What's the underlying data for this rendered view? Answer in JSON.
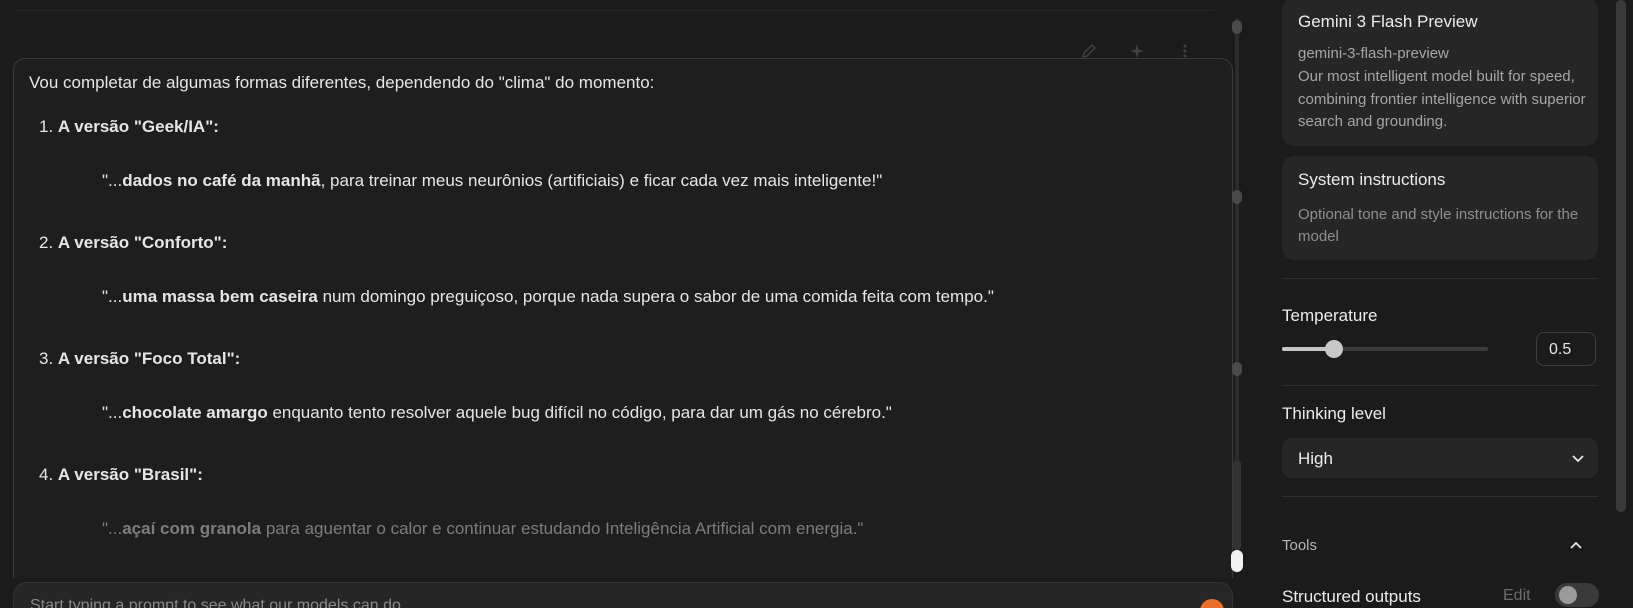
{
  "chat": {
    "intro": "Vou completar de algumas formas diferentes, dependendo do \"clima\" do momento:",
    "items": [
      {
        "num": "1.",
        "title": "A versão \"Geek/IA\":",
        "quote_prefix": "\"...",
        "quote_bold": "dados no café da manhã",
        "quote_rest": ", para treinar meus neurônios (artificiais) e ficar cada vez mais inteligente!\""
      },
      {
        "num": "2.",
        "title": "A versão \"Conforto\":",
        "quote_prefix": "\"...",
        "quote_bold": "uma massa bem caseira",
        "quote_rest": " num domingo preguiçoso, porque nada supera o sabor de uma comida feita com tempo.\""
      },
      {
        "num": "3.",
        "title": "A versão \"Foco Total\":",
        "quote_prefix": "\"...",
        "quote_bold": "chocolate amargo",
        "quote_rest": " enquanto tento resolver aquele bug difícil no código, para dar um gás no cérebro.\""
      },
      {
        "num": "4.",
        "title": "A versão \"Brasil\":",
        "quote_prefix": "\"...",
        "quote_bold": "açaí com granola",
        "quote_rest": " para aguentar o calor e continuar estudando Inteligência Artificial com energia.\""
      }
    ]
  },
  "prompt": {
    "placeholder": "Start typing a prompt to see what our models can do"
  },
  "panel": {
    "model": {
      "title": "Gemini 3 Flash Preview",
      "id": "gemini-3-flash-preview",
      "description": "Our most intelligent model built for speed, combining frontier intelligence with superior search and grounding."
    },
    "system": {
      "title": "System instructions",
      "description": "Optional tone and style instructions for the model"
    },
    "temperature": {
      "label": "Temperature",
      "value": "0.5",
      "fraction": 0.25
    },
    "thinking": {
      "label": "Thinking level",
      "selected": "High"
    },
    "tools": {
      "label": "Tools"
    },
    "structured": {
      "label": "Structured outputs",
      "edit": "Edit",
      "enabled": false
    }
  },
  "colors": {
    "accent": "#e8702a",
    "background": "#1b1b1b",
    "card": "#262626"
  }
}
